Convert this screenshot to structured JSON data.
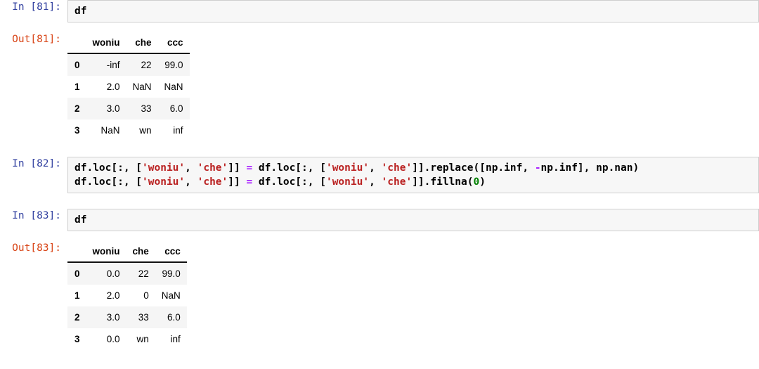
{
  "cells": [
    {
      "type": "input",
      "prompt": "In [81]:",
      "lines": [
        [
          {
            "t": "df",
            "c": "plain"
          }
        ]
      ]
    },
    {
      "type": "output",
      "prompt": "Out[81]:",
      "table": {
        "index_header": "",
        "columns": [
          "woniu",
          "che",
          "ccc"
        ],
        "index": [
          "0",
          "1",
          "2",
          "3"
        ],
        "rows": [
          [
            "-inf",
            "22",
            "99.0"
          ],
          [
            "2.0",
            "NaN",
            "NaN"
          ],
          [
            "3.0",
            "33",
            "6.0"
          ],
          [
            "NaN",
            "wn",
            "inf"
          ]
        ]
      }
    },
    {
      "type": "input",
      "prompt": "In [82]:",
      "lines": [
        [
          {
            "t": "df.loc[:, [",
            "c": "plain"
          },
          {
            "t": "'woniu'",
            "c": "str"
          },
          {
            "t": ", ",
            "c": "plain"
          },
          {
            "t": "'che'",
            "c": "str"
          },
          {
            "t": "]] ",
            "c": "plain"
          },
          {
            "t": "=",
            "c": "op"
          },
          {
            "t": " df.loc[:, [",
            "c": "plain"
          },
          {
            "t": "'woniu'",
            "c": "str"
          },
          {
            "t": ", ",
            "c": "plain"
          },
          {
            "t": "'che'",
            "c": "str"
          },
          {
            "t": "]].replace([np.inf, ",
            "c": "plain"
          },
          {
            "t": "-",
            "c": "op"
          },
          {
            "t": "np.inf], np.nan)",
            "c": "plain"
          }
        ],
        [
          {
            "t": "df.loc[:, [",
            "c": "plain"
          },
          {
            "t": "'woniu'",
            "c": "str"
          },
          {
            "t": ", ",
            "c": "plain"
          },
          {
            "t": "'che'",
            "c": "str"
          },
          {
            "t": "]] ",
            "c": "plain"
          },
          {
            "t": "=",
            "c": "op"
          },
          {
            "t": " df.loc[:, [",
            "c": "plain"
          },
          {
            "t": "'woniu'",
            "c": "str"
          },
          {
            "t": ", ",
            "c": "plain"
          },
          {
            "t": "'che'",
            "c": "str"
          },
          {
            "t": "]].fillna(",
            "c": "plain"
          },
          {
            "t": "0",
            "c": "num"
          },
          {
            "t": ")",
            "c": "plain"
          }
        ]
      ]
    },
    {
      "type": "input",
      "prompt": "In [83]:",
      "lines": [
        [
          {
            "t": "df",
            "c": "plain"
          }
        ]
      ]
    },
    {
      "type": "output",
      "prompt": "Out[83]:",
      "table": {
        "index_header": "",
        "columns": [
          "woniu",
          "che",
          "ccc"
        ],
        "index": [
          "0",
          "1",
          "2",
          "3"
        ],
        "rows": [
          [
            "0.0",
            "22",
            "99.0"
          ],
          [
            "2.0",
            "0",
            "NaN"
          ],
          [
            "3.0",
            "33",
            "6.0"
          ],
          [
            "0.0",
            "wn",
            "inf"
          ]
        ]
      }
    }
  ],
  "colors": {
    "prompt_in": "#303F9F",
    "prompt_out": "#D84315",
    "string": "#BA2121",
    "operator": "#AA22FF",
    "number": "#008000",
    "code_bg": "#F7F7F7",
    "code_border": "#CFCFCF",
    "row_stripe": "#F5F5F5",
    "page_bg": "#FFFFFF"
  }
}
